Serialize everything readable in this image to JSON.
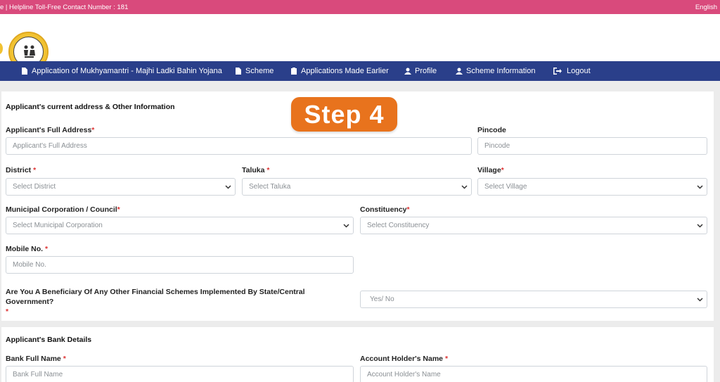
{
  "topbar": {
    "helpline": "e | Helpline Toll-Free Contact Number : 181",
    "language": "English"
  },
  "header": {
    "logo_icon": "department-seal-icon"
  },
  "nav": {
    "items": [
      {
        "label": "Application of Mukhyamantri - Majhi Ladki Bahin Yojana",
        "icon": "document-icon"
      },
      {
        "label": "Scheme",
        "icon": "file-icon"
      },
      {
        "label": "Applications Made Earlier",
        "icon": "clipboard-icon"
      },
      {
        "label": "Profile",
        "icon": "user-icon"
      },
      {
        "label": "Scheme Information",
        "icon": "user-icon"
      },
      {
        "label": "Logout",
        "icon": "logout-icon"
      }
    ]
  },
  "step_badge": "Step 4",
  "address_section": {
    "title": "Applicant's current address & Other Information",
    "full_address": {
      "label": "Applicant's Full Address",
      "required": "*",
      "placeholder": "Applicant's Full Address"
    },
    "pincode": {
      "label": "Pincode",
      "placeholder": "Pincode"
    },
    "district": {
      "label": "District",
      "required": "*",
      "selected": "Select District"
    },
    "taluka": {
      "label": "Taluka",
      "required": "*",
      "selected": "Select Taluka"
    },
    "village": {
      "label": "Village",
      "required": "*",
      "selected": "Select Village"
    },
    "municipal": {
      "label": "Municipal Corporation / Council",
      "required": "*",
      "selected": "Select Municipal Corporation"
    },
    "constituency": {
      "label": "Constituency",
      "required": "*",
      "selected": "Select Constituency"
    },
    "mobile": {
      "label": "Mobile No.",
      "required": "*",
      "placeholder": "Mobile No."
    },
    "beneficiary": {
      "question": "Are You A Beneficiary Of Any Other Financial Schemes Implemented By State/Central Government?",
      "required": "*",
      "selected": "Yes/ No"
    }
  },
  "bank_section": {
    "title": "Applicant's Bank Details",
    "bank_name": {
      "label": "Bank Full Name",
      "required": "*",
      "placeholder": "Bank Full Name"
    },
    "holder_name": {
      "label": "Account Holder's Name",
      "required": "*",
      "placeholder": "Account Holder's Name"
    }
  },
  "colors": {
    "topbar": "#d94a7c",
    "nav": "#2a3f8a",
    "step_badge": "#e8731d",
    "required": "#d33333"
  }
}
